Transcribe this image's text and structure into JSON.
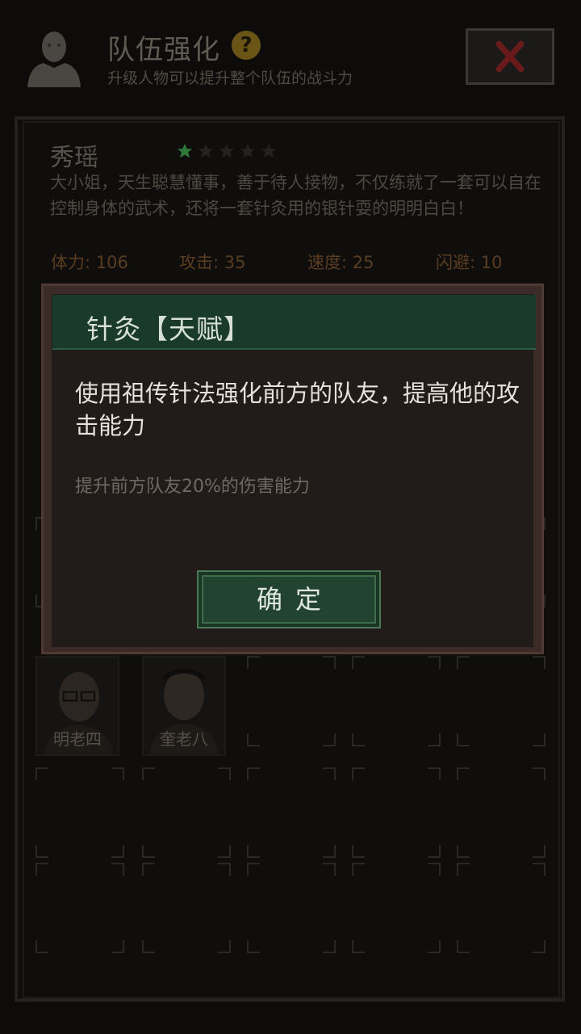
{
  "header": {
    "title": "队伍强化",
    "help_glyph": "?",
    "subtitle": "升级人物可以提升整个队伍的战斗力"
  },
  "character": {
    "name": "秀瑶",
    "stars_filled": 1,
    "stars_total": 5,
    "description": "大小姐，天生聪慧懂事，善于待人接物，不仅练就了一套可以自在控制身体的武术，还将一套针灸用的银针耍的明明白白！",
    "stats": [
      {
        "label": "体力: 106"
      },
      {
        "label": "攻击: 35"
      },
      {
        "label": "速度: 25"
      },
      {
        "label": "闪避: 10"
      }
    ]
  },
  "team": [
    {
      "name": "明老四"
    },
    {
      "name": "奎老八"
    }
  ],
  "modal": {
    "title": "针灸【天赋】",
    "body": "使用祖传针法强化前方的队友，提高他的攻击能力",
    "note": "提升前方队友20%的伤害能力",
    "confirm_label": "确定"
  },
  "colors": {
    "accent_green": "#1a3a2b",
    "star_green": "#2f7a3a",
    "help_gold": "#6b5516",
    "close_red": "#7a1c1c"
  }
}
